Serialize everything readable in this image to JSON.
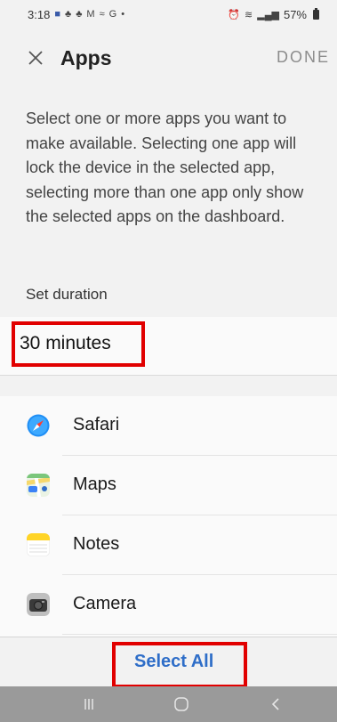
{
  "status_bar": {
    "time": "3:18",
    "battery": "57%",
    "colors": {
      "notification_blue": "#3a5ba9"
    }
  },
  "header": {
    "title": "Apps",
    "done_label": "DONE",
    "close_icon": "close-icon"
  },
  "description": "Select one or more apps you want to make available. Selecting one app will lock the device in the selected app, selecting more than one app only show the selected apps on the dashboard.",
  "duration": {
    "label": "Set duration",
    "value": "30 minutes"
  },
  "apps": [
    {
      "label": "Safari",
      "icon": "safari-icon"
    },
    {
      "label": "Maps",
      "icon": "maps-icon"
    },
    {
      "label": "Notes",
      "icon": "notes-icon"
    },
    {
      "label": "Camera",
      "icon": "camera-icon"
    }
  ],
  "footer": {
    "select_all_label": "Select All",
    "accent_color": "#2f6ec8"
  },
  "annotations": {
    "highlight_color": "#e10000"
  }
}
